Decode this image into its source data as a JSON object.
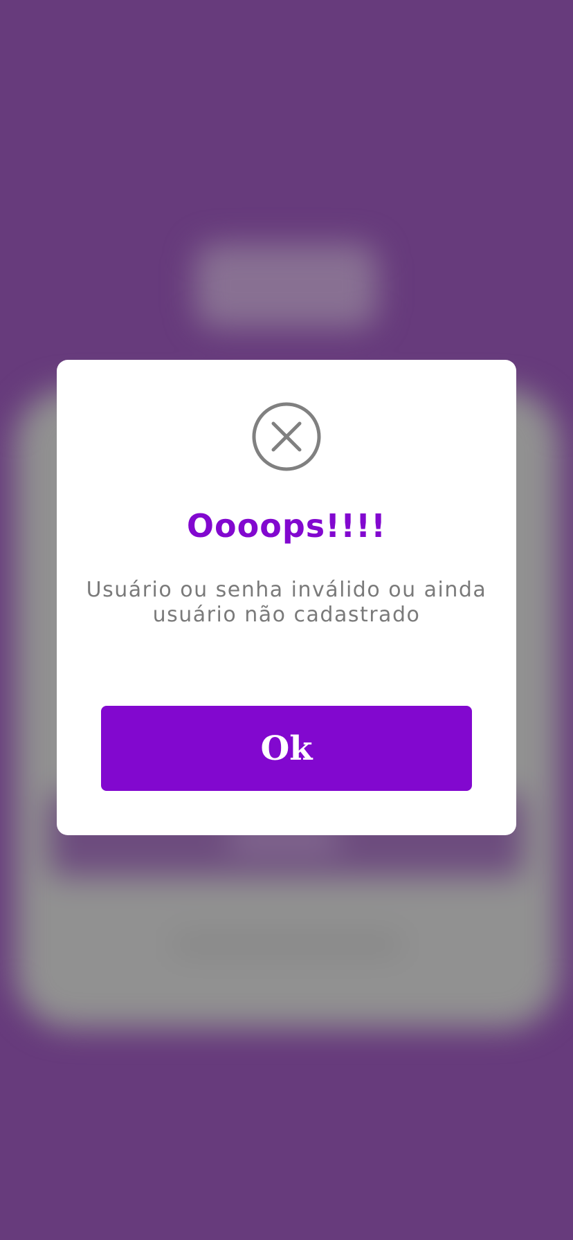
{
  "dialog": {
    "icon": "close-circle-icon",
    "title": "Oooops!!!!",
    "message": "Usuário ou senha inválido ou ainda usuário não cadastrado",
    "ok_label": "Ok"
  },
  "colors": {
    "background": "#673b7c",
    "accent": "#8208cf",
    "message_text": "#7a7a7a",
    "icon_stroke": "#808080",
    "dialog_background": "#ffffff"
  }
}
